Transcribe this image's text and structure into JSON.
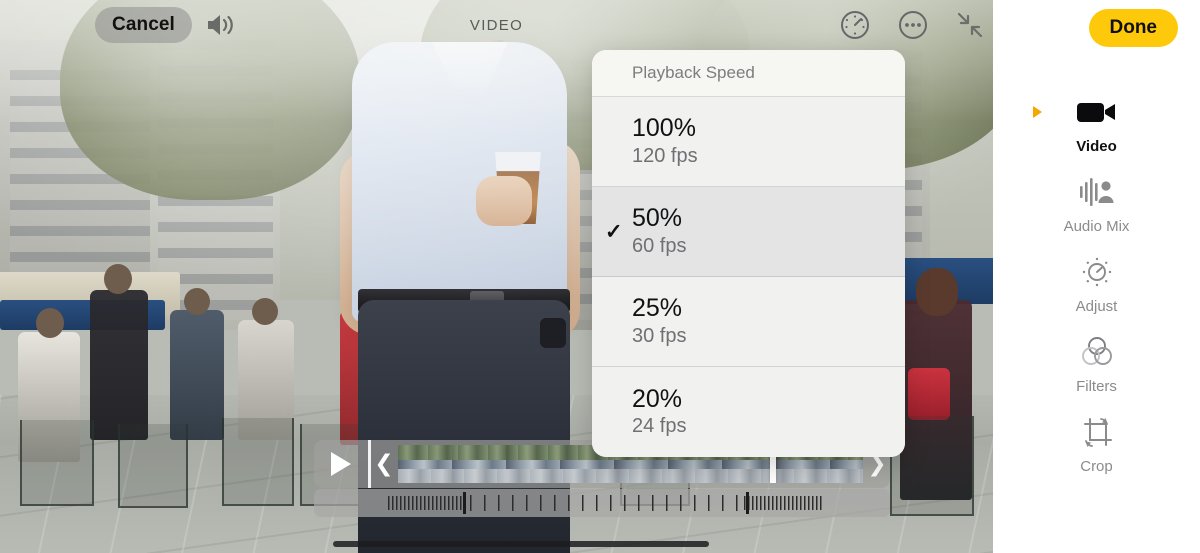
{
  "toolbar": {
    "cancel_label": "Cancel",
    "title": "VIDEO",
    "speaker_icon": "speaker-wave-icon",
    "speed_icon": "speedometer-icon",
    "more_icon": "ellipsis-circle-icon",
    "collapse_icon": "arrows-collapse-icon",
    "done_label": "Done",
    "done_color": "#ffc90b"
  },
  "speed_menu": {
    "header": "Playback Speed",
    "checkmark": "✓",
    "options": [
      {
        "percent": "100%",
        "fps": "120 fps",
        "selected": false
      },
      {
        "percent": "50%",
        "fps": "60 fps",
        "selected": true
      },
      {
        "percent": "25%",
        "fps": "30 fps",
        "selected": false
      },
      {
        "percent": "20%",
        "fps": "24 fps",
        "selected": false
      }
    ]
  },
  "timeline": {
    "play_icon": "play-triangle-icon",
    "trim_left_icon": "chevron-left-trim-handle",
    "trim_right_icon": "chevron-right-trim-handle",
    "trim_left_glyph": "❮",
    "trim_right_glyph": "❯",
    "playhead_name": "playhead-scrubber"
  },
  "speed_ramp": {
    "name": "slow-motion-ramp-control"
  },
  "sidebar": {
    "items": [
      {
        "label": "Video",
        "icon": "video-camera-icon",
        "active": true
      },
      {
        "label": "Audio Mix",
        "icon": "audio-mix-icon",
        "active": false
      },
      {
        "label": "Adjust",
        "icon": "adjust-dial-icon",
        "active": false
      },
      {
        "label": "Filters",
        "icon": "filters-circles-icon",
        "active": false
      },
      {
        "label": "Crop",
        "icon": "crop-rotate-icon",
        "active": false
      }
    ],
    "active_marker_color": "#f5a700"
  }
}
